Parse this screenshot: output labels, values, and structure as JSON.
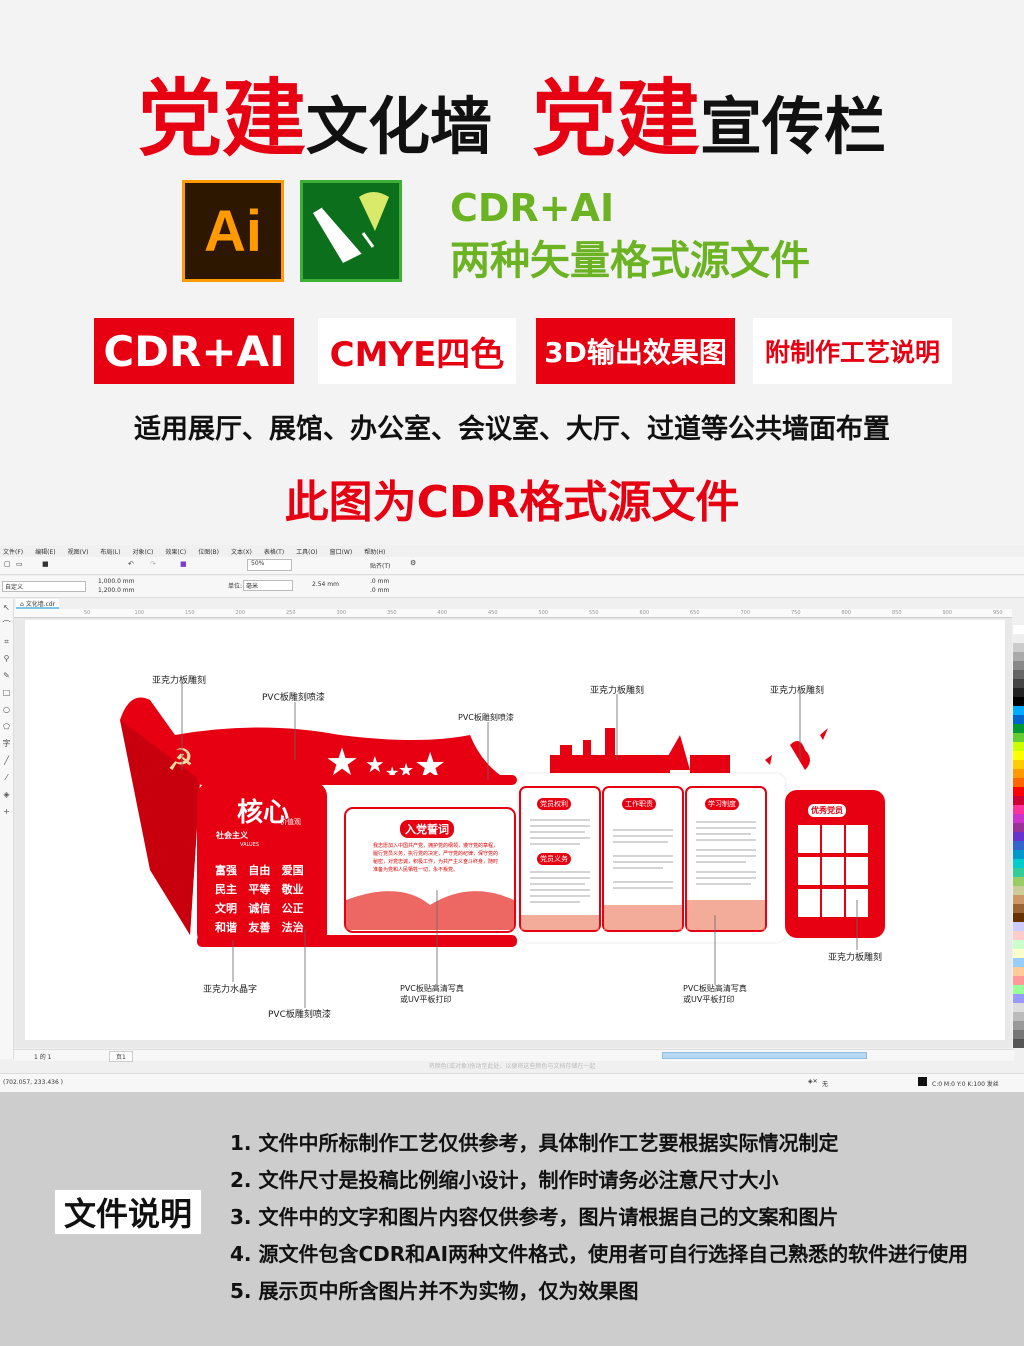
{
  "hero": {
    "title_parts": [
      {
        "text": "党建",
        "style": "red"
      },
      {
        "text": "文化墙",
        "style": "black"
      },
      {
        "text": "  ",
        "style": "black"
      },
      {
        "text": "党建",
        "style": "red"
      },
      {
        "text": "宣传栏",
        "style": "black"
      }
    ],
    "ai_icon": "Ai",
    "format_line1": "CDR+AI",
    "format_line2": "两种矢量格式源文件",
    "badges": [
      "CDR+AI",
      "CMYE四色",
      "3D输出效果图",
      "附制作工艺说明"
    ],
    "usage": "适用展厅、展馆、办公室、会议室、大厅、过道等公共墙面布置",
    "source_note": "此图为CDR格式源文件"
  },
  "colors": {
    "red": "#e60012",
    "green": "#6bb322",
    "ai_orange": "#ff9a00"
  },
  "corel": {
    "menu": [
      "文件(F)",
      "编辑(E)",
      "视图(V)",
      "布局(L)",
      "对象(C)",
      "效果(C)",
      "位图(B)",
      "文本(X)",
      "表格(T)",
      "工具(O)",
      "窗口(W)",
      "帮助(H)"
    ],
    "zoom": "50%",
    "snap": "贴齐(T)",
    "preset": "自定义",
    "width": "1,000.0 mm",
    "height": "1,200.0 mm",
    "unit_label": "单位:",
    "unit": "毫米",
    "nudge": "2.54 mm",
    "dup_x": ".0 mm",
    "dup_y": ".0 mm",
    "doc_tab": "文化墙.cdr",
    "ruler": [
      "50",
      "100",
      "150",
      "200",
      "250",
      "300",
      "350",
      "400",
      "450",
      "500",
      "550",
      "600",
      "650",
      "700",
      "750",
      "800",
      "850",
      "900",
      "950"
    ],
    "page_nav": "1 的 1",
    "page_tab": "页1",
    "hint": "将颜色(或对象)拖动至此处，以便将这些颜色与文档存储在一起",
    "coords": "(702.057, 233.436 )",
    "fill_none": "无",
    "outline": "C:0 M:0 Y:0 K:100 发丝"
  },
  "design": {
    "labels": [
      "亚克力板雕刻",
      "PVC板雕刻喷漆",
      "PVC板雕刻喷漆",
      "亚克力板雕刻",
      "亚克力板雕刻",
      "亚克力板雕刻",
      "亚克力水晶字",
      "PVC板雕刻喷漆",
      "PVC板贴高清写真\n或UV平板打印",
      "PVC板贴高清写真\n或UV平板打印"
    ],
    "core_title": "核心",
    "core_sub": "价值观",
    "core_socialism": "社会主义",
    "core_values_en": "VALUES",
    "values": [
      "富强",
      "自由",
      "爱国",
      "民主",
      "平等",
      "敬业",
      "文明",
      "诚信",
      "公正",
      "和谐",
      "友善",
      "法治"
    ],
    "oath_title": "入党誓词",
    "oath_text": "我志愿加入中国共产党，拥护党的纲领，遵守党的章程，履行党员义务，执行党的决定，严守党的纪律，保守党的秘密，对党忠诚，积极工作，为共产主义奋斗终身，随时准备为党和人民牺牲一切，永不叛党。",
    "panels": [
      "党员权利",
      "工作职责",
      "学习制度"
    ],
    "panel1_sub": "党员义务",
    "honor": "优秀党员"
  },
  "notes": {
    "title": "文件说明",
    "items": [
      "1. 文件中所标制作工艺仅供参考，具体制作工艺要根据实际情况制定",
      "2. 文件尺寸是投稿比例缩小设计，制作时请务必注意尺寸大小",
      "3. 文件中的文字和图片内容仅供参考，图片请根据自己的文案和图片",
      "4. 源文件包含CDR和AI两种文件格式，使用者可自行选择自己熟悉的软件进行使用",
      "5. 展示页中所含图片并不为实物，仅为效果图"
    ]
  }
}
